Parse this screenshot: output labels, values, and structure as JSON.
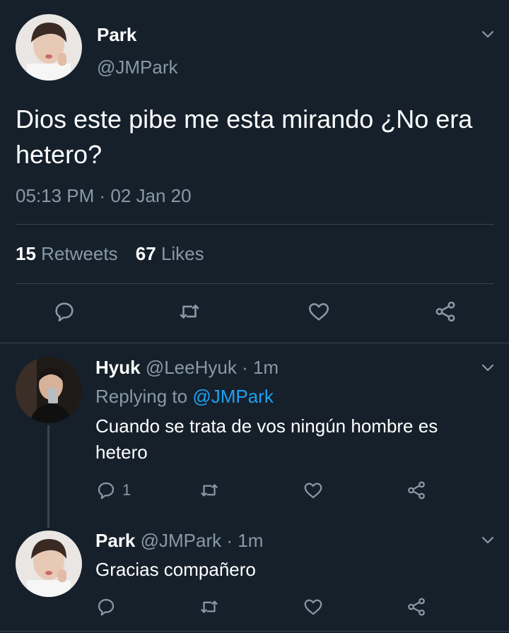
{
  "tweet": {
    "name": "Park",
    "handle": "@JMPark",
    "text": "Dios este pibe me esta mirando ¿No era hetero?",
    "timestamp": "05:13 PM · 02 Jan 20",
    "retweets_count": "15",
    "retweets_label": "Retweets",
    "likes_count": "67",
    "likes_label": "Likes",
    "icons": [
      "reply-icon",
      "retweet-icon",
      "like-icon",
      "share-icon"
    ]
  },
  "replies": [
    {
      "name": "Hyuk",
      "handle": "@LeeHyuk",
      "time": "· 1m",
      "replying_prefix": "Replying to",
      "replying_handle": "@JMPark",
      "text": "Cuando se trata de vos ningún hombre es hetero",
      "reply_count": "1"
    },
    {
      "name": "Park",
      "handle": "@JMPark",
      "time": "· 1m",
      "text": "Gracias compañero"
    }
  ],
  "colors": {
    "background": "#15202b",
    "muted": "#8899a6",
    "link": "#1da1f2",
    "divider": "#38444d"
  }
}
